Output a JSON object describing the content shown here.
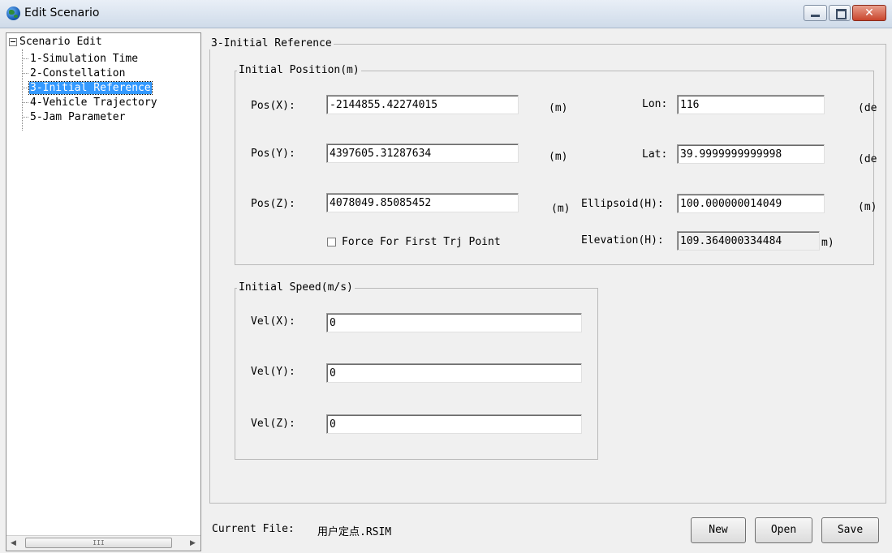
{
  "window": {
    "title": "Edit Scenario"
  },
  "tree": {
    "root": "Scenario Edit",
    "items": [
      {
        "label": "1-Simulation Time"
      },
      {
        "label": "2-Constellation"
      },
      {
        "label": "3-Initial Reference",
        "selected": true
      },
      {
        "label": "4-Vehicle Trajectory"
      },
      {
        "label": "5-Jam Parameter"
      }
    ],
    "scrollbar_grip": "III"
  },
  "section": {
    "title": "3-Initial Reference"
  },
  "position": {
    "title": "Initial Position(m)",
    "x": {
      "label": "Pos(X):",
      "value": "-2144855.42274015",
      "unit": "(m)"
    },
    "y": {
      "label": "Pos(Y):",
      "value": "4397605.31287634",
      "unit": "(m)"
    },
    "z": {
      "label": "Pos(Z):",
      "value": "4078049.85085452",
      "unit": "(m)"
    },
    "lon": {
      "label": "Lon:",
      "value": "116",
      "unit": "(de"
    },
    "lat": {
      "label": "Lat:",
      "value": "39.9999999999998",
      "unit": "(de"
    },
    "ellipsoid": {
      "label": "Ellipsoid(H):",
      "value": "100.000000014049",
      "unit": "(m)"
    },
    "elevation": {
      "label": "Elevation(H):",
      "value": "109.364000334484",
      "unit": "m)"
    },
    "force_checkbox": {
      "label": "Force For First Trj Point",
      "checked": false
    }
  },
  "speed": {
    "title": "Initial Speed(m/s)",
    "x": {
      "label": "Vel(X):",
      "value": "0"
    },
    "y": {
      "label": "Vel(Y):",
      "value": "0"
    },
    "z": {
      "label": "Vel(Z):",
      "value": "0"
    }
  },
  "footer": {
    "current_file_label": "Current File:",
    "current_file": "用户定点.RSIM",
    "new_label": "New",
    "open_label": "Open",
    "save_label": "Save"
  }
}
